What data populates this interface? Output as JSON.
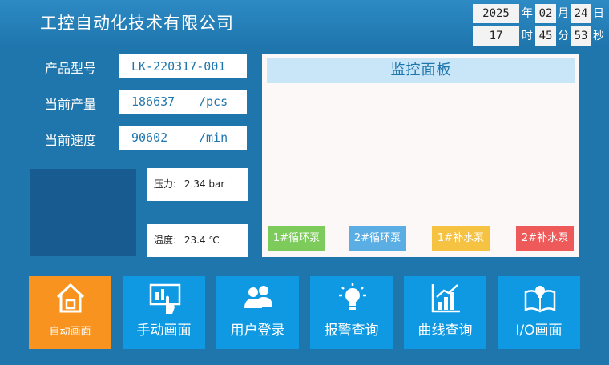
{
  "header": {
    "title": "工控自动化技术有限公司",
    "date": {
      "year": "2025",
      "year_unit": "年",
      "month": "02",
      "month_unit": "月",
      "day": "24",
      "day_unit": "日"
    },
    "time": {
      "hour": "17",
      "hour_unit": "时",
      "minute": "45",
      "minute_unit": "分",
      "second": "53",
      "second_unit": "秒"
    }
  },
  "info": {
    "model_label": "产品型号",
    "model_value": "LK-220317-001",
    "output_label": "当前产量",
    "output_value": "186637",
    "output_unit": "/pcs",
    "speed_label": "当前速度",
    "speed_value": "90602",
    "speed_unit": "/min"
  },
  "readings": {
    "pressure_label": "压力:",
    "pressure_value": "2.34 bar",
    "temperature_label": "温度:",
    "temperature_value": "23.4 ℃"
  },
  "panel": {
    "title": "监控面板",
    "pumps": [
      {
        "label": "1#循环泵",
        "color": "#7ccb5b"
      },
      {
        "label": "2#循环泵",
        "color": "#5aaee3"
      },
      {
        "label": "1#补水泵",
        "color": "#f5c242"
      },
      {
        "label": "2#补水泵",
        "color": "#ee5a5a"
      }
    ]
  },
  "nav": [
    {
      "label": "自动画面",
      "icon": "home-icon",
      "active": true
    },
    {
      "label": "手动画面",
      "icon": "touch-screen-icon",
      "active": false
    },
    {
      "label": "用户登录",
      "icon": "users-icon",
      "active": false
    },
    {
      "label": "报警查询",
      "icon": "bulb-icon",
      "active": false
    },
    {
      "label": "曲线查询",
      "icon": "chart-icon",
      "active": false
    },
    {
      "label": "I/O画面",
      "icon": "book-bulb-icon",
      "active": false
    }
  ],
  "colors": {
    "background": "#1f76ad",
    "active_nav": "#f7931e",
    "nav": "#0e99e2",
    "panel_header": "#c9e6f9"
  }
}
